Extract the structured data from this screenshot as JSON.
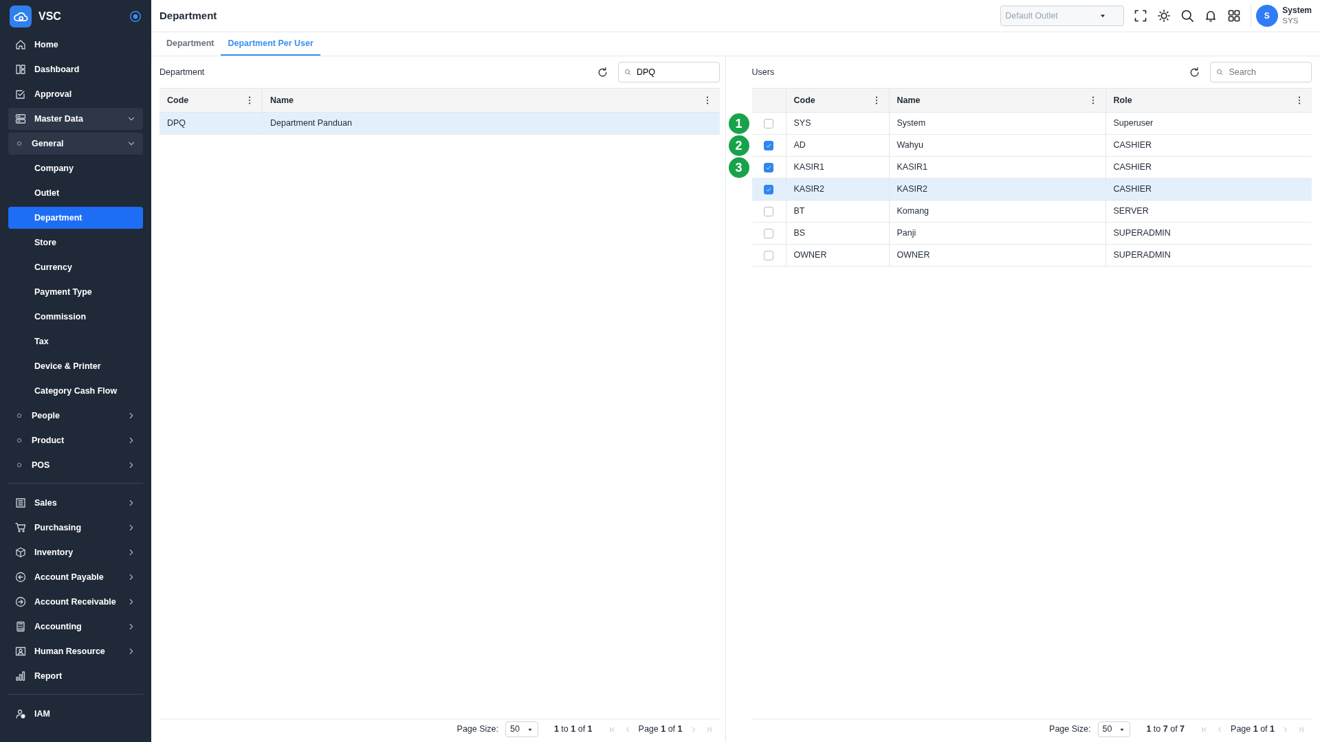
{
  "app": {
    "name": "VSC"
  },
  "sidebar": {
    "sections": [
      {
        "items": [
          {
            "label": "Home"
          },
          {
            "label": "Dashboard"
          },
          {
            "label": "Approval"
          },
          {
            "label": "Master Data",
            "expanded": true,
            "children": [
              {
                "label": "General",
                "expanded": true,
                "children": [
                  {
                    "label": "Company",
                    "selected": false
                  },
                  {
                    "label": "Outlet",
                    "selected": false
                  },
                  {
                    "label": "Department",
                    "selected": true
                  },
                  {
                    "label": "Store",
                    "selected": false
                  },
                  {
                    "label": "Currency",
                    "selected": false
                  },
                  {
                    "label": "Payment Type",
                    "selected": false
                  },
                  {
                    "label": "Commission",
                    "selected": false
                  },
                  {
                    "label": "Tax",
                    "selected": false
                  },
                  {
                    "label": "Device & Printer",
                    "selected": false
                  },
                  {
                    "label": "Category Cash Flow",
                    "selected": false
                  }
                ]
              },
              {
                "label": "People",
                "expanded": false
              },
              {
                "label": "Product",
                "expanded": false
              },
              {
                "label": "POS",
                "expanded": false
              }
            ]
          }
        ]
      },
      {
        "items": [
          {
            "label": "Sales",
            "expanded": false
          },
          {
            "label": "Purchasing",
            "expanded": false
          },
          {
            "label": "Inventory",
            "expanded": false
          },
          {
            "label": "Account Payable",
            "expanded": false
          },
          {
            "label": "Account Receivable",
            "expanded": false
          },
          {
            "label": "Accounting",
            "expanded": false
          },
          {
            "label": "Human Resource",
            "expanded": false
          },
          {
            "label": "Report"
          }
        ]
      },
      {
        "items": [
          {
            "label": "IAM"
          }
        ]
      }
    ]
  },
  "topbar": {
    "title": "Department",
    "outlet": {
      "placeholder": "Default Outlet"
    },
    "user": {
      "initial": "S",
      "name": "System",
      "code": "SYS"
    }
  },
  "tabs": [
    {
      "label": "Department",
      "selected": false
    },
    {
      "label": "Department Per User",
      "selected": true
    }
  ],
  "department_panel": {
    "title": "Department",
    "search": {
      "value": "DPQ"
    },
    "columns": [
      "Code",
      "Name"
    ],
    "rows": [
      {
        "cells": [
          "DPQ",
          "Department Panduan"
        ],
        "selected": true
      }
    ],
    "footer": {
      "page_size_label": "Page Size:",
      "page_size": "50",
      "range": "**1** to **1** of **1**",
      "page": "Page **1** of **1**"
    }
  },
  "users_panel": {
    "title": "Users",
    "search": {
      "placeholder": "Search"
    },
    "columns": [
      "Code",
      "Name",
      "Role"
    ],
    "rows": [
      {
        "cells": [
          "SYS",
          "System",
          "Superuser"
        ],
        "checked": false,
        "selected": false
      },
      {
        "cells": [
          "AD",
          "Wahyu",
          "CASHIER"
        ],
        "checked": true,
        "selected": false
      },
      {
        "cells": [
          "KASIR1",
          "KASIR1",
          "CASHIER"
        ],
        "checked": true,
        "selected": false
      },
      {
        "cells": [
          "KASIR2",
          "KASIR2",
          "CASHIER"
        ],
        "checked": true,
        "selected": true
      },
      {
        "cells": [
          "BT",
          "Komang",
          "SERVER"
        ],
        "checked": false,
        "selected": false
      },
      {
        "cells": [
          "BS",
          "Panji",
          "SUPERADMIN"
        ],
        "checked": false,
        "selected": false
      },
      {
        "cells": [
          "OWNER",
          "OWNER",
          "SUPERADMIN"
        ],
        "checked": false,
        "selected": false
      }
    ],
    "footer": {
      "page_size_label": "Page Size:",
      "page_size": "50",
      "range": "**1** to **7** of **7**",
      "page": "Page **1** of **1**"
    }
  },
  "callouts": [
    {
      "label": "1"
    },
    {
      "label": "2"
    },
    {
      "label": "3"
    }
  ]
}
